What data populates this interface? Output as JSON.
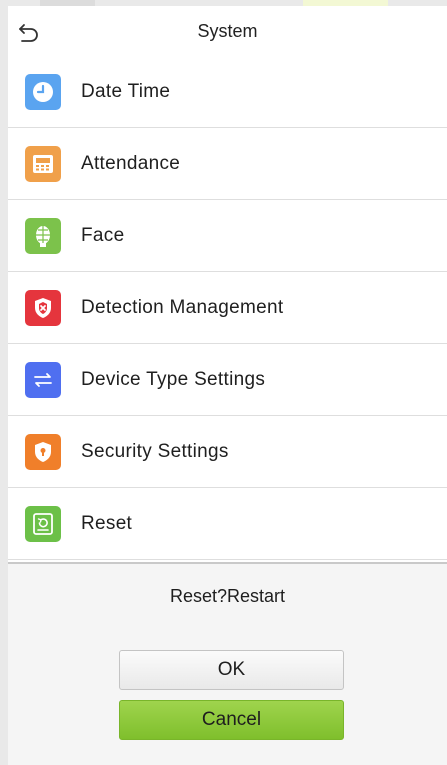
{
  "header": {
    "title": "System",
    "back_icon": "back-arrow-icon"
  },
  "menu": {
    "items": [
      {
        "label": "Date Time",
        "icon": "clock-icon",
        "color": "#5aa4f0"
      },
      {
        "label": "Attendance",
        "icon": "attendance-device-icon",
        "color": "#f0a04a"
      },
      {
        "label": "Face",
        "icon": "face-icon",
        "color": "#7cc24b"
      },
      {
        "label": "Detection Management",
        "icon": "shield-cross-icon",
        "color": "#e5353d"
      },
      {
        "label": "Device Type Settings",
        "icon": "switch-arrows-icon",
        "color": "#4f6ff0"
      },
      {
        "label": "Security Settings",
        "icon": "shield-lock-icon",
        "color": "#f07f2a"
      },
      {
        "label": "Reset",
        "icon": "reset-device-icon",
        "color": "#6cc048"
      }
    ]
  },
  "dialog": {
    "message": "Reset?Restart",
    "ok_label": "OK",
    "cancel_label": "Cancel",
    "cancel_color": "#86c431"
  }
}
